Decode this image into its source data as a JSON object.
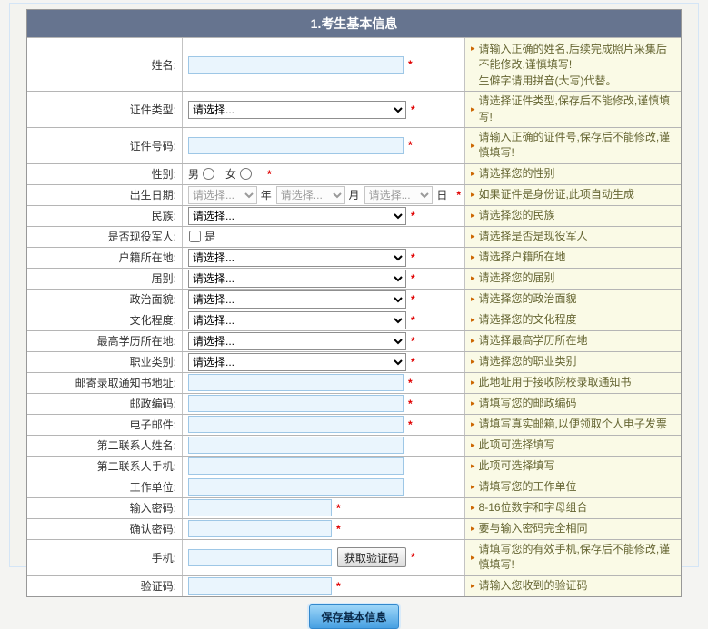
{
  "header": {
    "title": "1.考生基本信息"
  },
  "ui": {
    "hint_bullet": "▸",
    "required_marker": "*",
    "colors": {
      "header_bg": "#66748f",
      "container_border": "#d4e5f6",
      "container_bg": "#f3f3ef",
      "hint_bg": "#fafae6",
      "hint_text": "#666633",
      "hint_bullet": "#cc6600",
      "required_red": "#e00000",
      "input_bg": "#eaf5fd",
      "input_border": "#9ec7e6",
      "accent_blue": "#47a0e2",
      "accent_light": "#9ed6f8",
      "accent_border": "#3388cc"
    }
  },
  "form": {
    "rows": [
      {
        "key": "name",
        "label": "姓名:",
        "required": true,
        "tall": true,
        "control": {
          "type": "text",
          "size": "normal",
          "value": ""
        },
        "hint": "请输入正确的姓名,后续完成照片采集后不能修改,谨慎填写!\n生僻字请用拼音(大写)代替。"
      },
      {
        "key": "id-type",
        "label": "证件类型:",
        "required": true,
        "control": {
          "type": "select",
          "selected": "请选择..."
        },
        "hint": "请选择证件类型,保存后不能修改,谨慎填写!"
      },
      {
        "key": "id-number",
        "label": "证件号码:",
        "required": true,
        "control": {
          "type": "text",
          "size": "normal",
          "value": ""
        },
        "hint": "请输入正确的证件号,保存后不能修改,谨慎填写!"
      },
      {
        "key": "gender",
        "label": "性别:",
        "required": true,
        "control": {
          "type": "radio",
          "options": [
            "男",
            "女"
          ]
        },
        "hint": "请选择您的性别"
      },
      {
        "key": "birth-date",
        "label": "出生日期:",
        "required": true,
        "control": {
          "type": "birthdate",
          "placeholder": "请选择...",
          "units": [
            "年",
            "月",
            "日"
          ]
        },
        "hint": "如果证件是身份证,此项自动生成"
      },
      {
        "key": "ethnicity",
        "label": "民族:",
        "required": true,
        "control": {
          "type": "select",
          "selected": "请选择..."
        },
        "hint": "请选择您的民族"
      },
      {
        "key": "active-military",
        "label": "是否现役军人:",
        "required": false,
        "control": {
          "type": "checkbox",
          "label": "是",
          "checked": false
        },
        "hint": "请选择是否是现役军人"
      },
      {
        "key": "household-registration",
        "label": "户籍所在地:",
        "required": true,
        "control": {
          "type": "select",
          "selected": "请选择..."
        },
        "hint": "请选择户籍所在地"
      },
      {
        "key": "category",
        "label": "届别:",
        "required": true,
        "control": {
          "type": "select",
          "selected": "请选择..."
        },
        "hint": "请选择您的届别"
      },
      {
        "key": "political-status",
        "label": "政治面貌:",
        "required": true,
        "control": {
          "type": "select",
          "selected": "请选择..."
        },
        "hint": "请选择您的政治面貌"
      },
      {
        "key": "education-level",
        "label": "文化程度:",
        "required": true,
        "control": {
          "type": "select",
          "selected": "请选择..."
        },
        "hint": "请选择您的文化程度"
      },
      {
        "key": "highest-education-location",
        "label": "最高学历所在地:",
        "required": true,
        "control": {
          "type": "select",
          "selected": "请选择..."
        },
        "hint": "请选择最高学历所在地"
      },
      {
        "key": "occupation-type",
        "label": "职业类别:",
        "required": true,
        "control": {
          "type": "select",
          "selected": "请选择..."
        },
        "hint": "请选择您的职业类别"
      },
      {
        "key": "mailing-address",
        "label": "邮寄录取通知书地址:",
        "required": true,
        "control": {
          "type": "text",
          "size": "normal",
          "value": ""
        },
        "hint": "此地址用于接收院校录取通知书"
      },
      {
        "key": "postal-code",
        "label": "邮政编码:",
        "required": true,
        "control": {
          "type": "text",
          "size": "normal",
          "value": ""
        },
        "hint": "请填写您的邮政编码"
      },
      {
        "key": "email",
        "label": "电子邮件:",
        "required": true,
        "control": {
          "type": "text",
          "size": "normal",
          "value": ""
        },
        "hint": "请填写真实邮箱,以便领取个人电子发票"
      },
      {
        "key": "second-contact-name",
        "label": "第二联系人姓名:",
        "required": false,
        "control": {
          "type": "text",
          "size": "normal",
          "value": ""
        },
        "hint": "此项可选择填写"
      },
      {
        "key": "second-contact-phone",
        "label": "第二联系人手机:",
        "required": false,
        "control": {
          "type": "text",
          "size": "normal",
          "value": ""
        },
        "hint": "此项可选择填写"
      },
      {
        "key": "work-unit",
        "label": "工作单位:",
        "required": false,
        "control": {
          "type": "text",
          "size": "normal",
          "value": ""
        },
        "hint": "请填写您的工作单位"
      },
      {
        "key": "password",
        "label": "输入密码:",
        "required": true,
        "control": {
          "type": "text",
          "size": "narrow",
          "value": ""
        },
        "hint": "8-16位数字和字母组合"
      },
      {
        "key": "confirm-password",
        "label": "确认密码:",
        "required": true,
        "control": {
          "type": "text",
          "size": "narrow",
          "value": ""
        },
        "hint": "要与输入密码完全相同"
      },
      {
        "key": "mobile",
        "label": "手机:",
        "required": true,
        "control": {
          "type": "text-button",
          "size": "narrow",
          "value": "",
          "button_label": "获取验证码"
        },
        "hint": "请填写您的有效手机,保存后不能修改,谨慎填写!"
      },
      {
        "key": "verification-code",
        "label": "验证码:",
        "required": true,
        "control": {
          "type": "text",
          "size": "narrow",
          "value": ""
        },
        "hint": "请输入您收到的验证码"
      }
    ]
  },
  "footer": {
    "save_button": "保存基本信息"
  }
}
